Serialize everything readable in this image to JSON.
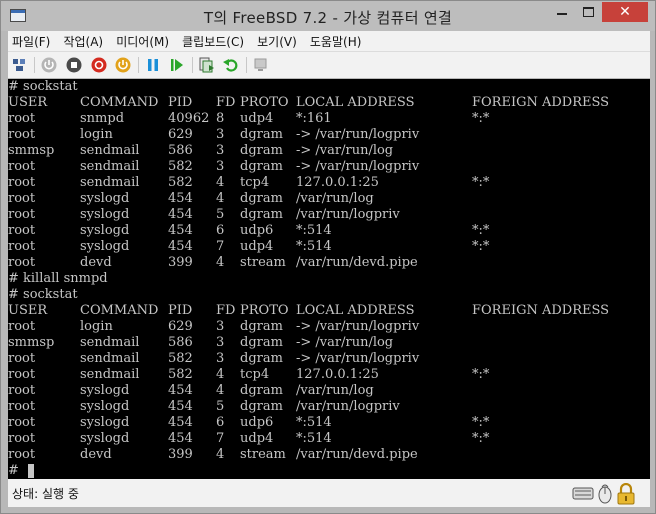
{
  "window": {
    "title": "T의 FreeBSD 7.2 - 가상 컴퓨터 연결",
    "close_label": "✕"
  },
  "menu": [
    "파일(F)",
    "작업(A)",
    "미디어(M)",
    "클립보드(C)",
    "보기(V)",
    "도움말(H)"
  ],
  "toolbar": {
    "buttons": [
      {
        "icon": "ctrl-alt-del-icon",
        "color": "#3b5b8f"
      },
      {
        "icon": "start-icon",
        "color": "#9a9a9a"
      },
      {
        "icon": "turn-off-icon",
        "color": "#4a4a4a"
      },
      {
        "icon": "shut-down-icon",
        "color": "#d42b20"
      },
      {
        "icon": "save-icon",
        "color": "#e2a21b"
      },
      {
        "icon": "pause-icon",
        "color": "#1a8fd8"
      },
      {
        "icon": "resume-icon",
        "color": "#2aa62a"
      },
      {
        "icon": "snapshot-icon",
        "color": "#2d7a2d"
      },
      {
        "icon": "revert-icon",
        "color": "#2aa62a"
      },
      {
        "icon": "enhanced-session-icon",
        "color": "#9a9a9a"
      }
    ]
  },
  "terminal": {
    "lines": [
      {
        "kind": "cmd",
        "text": "# sockstat"
      },
      {
        "kind": "row",
        "cols": [
          "USER",
          "COMMAND",
          "PID",
          "FD",
          "PROTO",
          "LOCAL ADDRESS",
          "FOREIGN ADDRESS"
        ]
      },
      {
        "kind": "row",
        "cols": [
          "root",
          "snmpd",
          "40962",
          "8",
          "udp4",
          "*:161",
          "*:*"
        ]
      },
      {
        "kind": "row",
        "cols": [
          "root",
          "login",
          "629",
          "3",
          "dgram",
          "-> /var/run/logpriv",
          ""
        ]
      },
      {
        "kind": "row",
        "cols": [
          "smmsp",
          "sendmail",
          "586",
          "3",
          "dgram",
          "-> /var/run/log",
          ""
        ]
      },
      {
        "kind": "row",
        "cols": [
          "root",
          "sendmail",
          "582",
          "3",
          "dgram",
          "-> /var/run/logpriv",
          ""
        ]
      },
      {
        "kind": "row",
        "cols": [
          "root",
          "sendmail",
          "582",
          "4",
          "tcp4",
          "127.0.0.1:25",
          "*:*"
        ]
      },
      {
        "kind": "row",
        "cols": [
          "root",
          "syslogd",
          "454",
          "4",
          "dgram",
          "/var/run/log",
          ""
        ]
      },
      {
        "kind": "row",
        "cols": [
          "root",
          "syslogd",
          "454",
          "5",
          "dgram",
          "/var/run/logpriv",
          ""
        ]
      },
      {
        "kind": "row",
        "cols": [
          "root",
          "syslogd",
          "454",
          "6",
          "udp6",
          "*:514",
          "*:*"
        ]
      },
      {
        "kind": "row",
        "cols": [
          "root",
          "syslogd",
          "454",
          "7",
          "udp4",
          "*:514",
          "*:*"
        ]
      },
      {
        "kind": "row",
        "cols": [
          "root",
          "devd",
          "399",
          "4",
          "stream",
          "/var/run/devd.pipe",
          ""
        ]
      },
      {
        "kind": "cmd",
        "text": "# killall snmpd"
      },
      {
        "kind": "cmd",
        "text": "# sockstat"
      },
      {
        "kind": "row",
        "cols": [
          "USER",
          "COMMAND",
          "PID",
          "FD",
          "PROTO",
          "LOCAL ADDRESS",
          "FOREIGN ADDRESS"
        ]
      },
      {
        "kind": "row",
        "cols": [
          "root",
          "login",
          "629",
          "3",
          "dgram",
          "-> /var/run/logpriv",
          ""
        ]
      },
      {
        "kind": "row",
        "cols": [
          "smmsp",
          "sendmail",
          "586",
          "3",
          "dgram",
          "-> /var/run/log",
          ""
        ]
      },
      {
        "kind": "row",
        "cols": [
          "root",
          "sendmail",
          "582",
          "3",
          "dgram",
          "-> /var/run/logpriv",
          ""
        ]
      },
      {
        "kind": "row",
        "cols": [
          "root",
          "sendmail",
          "582",
          "4",
          "tcp4",
          "127.0.0.1:25",
          "*:*"
        ]
      },
      {
        "kind": "row",
        "cols": [
          "root",
          "syslogd",
          "454",
          "4",
          "dgram",
          "/var/run/log",
          ""
        ]
      },
      {
        "kind": "row",
        "cols": [
          "root",
          "syslogd",
          "454",
          "5",
          "dgram",
          "/var/run/logpriv",
          ""
        ]
      },
      {
        "kind": "row",
        "cols": [
          "root",
          "syslogd",
          "454",
          "6",
          "udp6",
          "*:514",
          "*:*"
        ]
      },
      {
        "kind": "row",
        "cols": [
          "root",
          "syslogd",
          "454",
          "7",
          "udp4",
          "*:514",
          "*:*"
        ]
      },
      {
        "kind": "row",
        "cols": [
          "root",
          "devd",
          "399",
          "4",
          "stream",
          "/var/run/devd.pipe",
          ""
        ]
      },
      {
        "kind": "cmd",
        "text": "# "
      }
    ]
  },
  "status": {
    "text": "상태: 실행 중",
    "icons": [
      "keyboard-icon",
      "mouse-icon",
      "lock-icon"
    ]
  }
}
